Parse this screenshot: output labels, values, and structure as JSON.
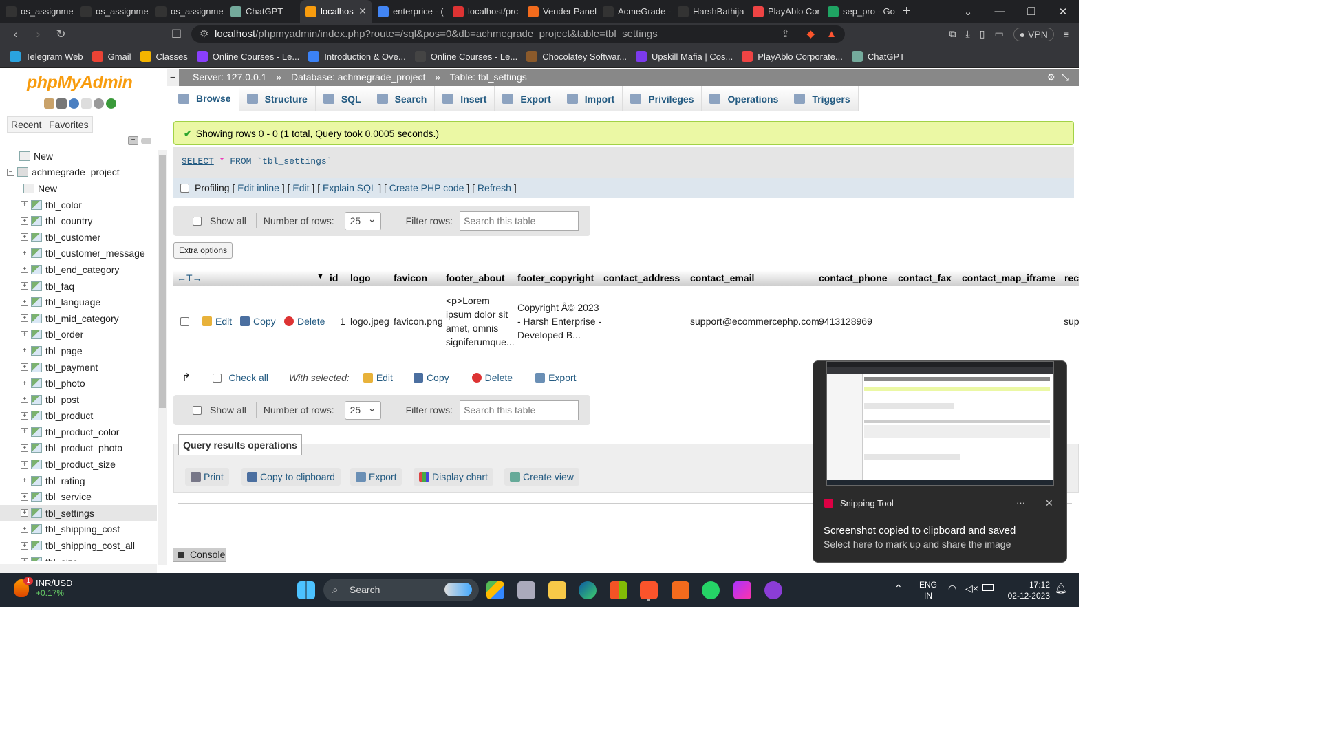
{
  "browser": {
    "tabs": [
      {
        "title": "os_assignme",
        "icon": "github-icon",
        "color": "#333"
      },
      {
        "title": "os_assignme",
        "icon": "github-icon",
        "color": "#333"
      },
      {
        "title": "os_assignme",
        "icon": "github-icon",
        "color": "#333"
      },
      {
        "title": "ChatGPT",
        "icon": "chatgpt-icon",
        "color": "#74aa9c"
      },
      {
        "title": "localhos",
        "icon": "phpmyadmin-icon",
        "color": "#f89c0e",
        "active": true
      },
      {
        "title": "enterprice - (",
        "icon": "google-icon",
        "color": "#4285f4"
      },
      {
        "title": "localhost/prc",
        "icon": "cart-icon",
        "color": "#d33"
      },
      {
        "title": "Vender Panel",
        "icon": "xampp-icon",
        "color": "#f26b1d"
      },
      {
        "title": "AcmeGrade -",
        "icon": "github-icon",
        "color": "#333"
      },
      {
        "title": "HarshBathija",
        "icon": "github-icon",
        "color": "#333"
      },
      {
        "title": "PlayAblo Cor",
        "icon": "location-icon",
        "color": "#e44"
      },
      {
        "title": "sep_pro - Go",
        "icon": "drive-icon",
        "color": "#1fa463"
      }
    ],
    "url_host": "localhost",
    "url_path": "/phpmyadmin/index.php?route=/sql&pos=0&db=achmegrade_project&table=tbl_settings",
    "vpn_label": "VPN",
    "bookmarks": [
      {
        "label": "Telegram Web",
        "color": "#2aa3df"
      },
      {
        "label": "Gmail",
        "color": "#ea4335"
      },
      {
        "label": "Classes",
        "color": "#f4b400"
      },
      {
        "label": "Online Courses - Le...",
        "color": "#8a3ffc"
      },
      {
        "label": "Introduction & Ove...",
        "color": "#3b82f6"
      },
      {
        "label": "Online Courses - Le...",
        "color": "#444"
      },
      {
        "label": "Chocolatey Softwar...",
        "color": "#8b5a2b"
      },
      {
        "label": "Upskill Mafia | Cos...",
        "color": "#7c3aed"
      },
      {
        "label": "PlayAblo Corporate...",
        "color": "#e44"
      },
      {
        "label": "ChatGPT",
        "color": "#74aa9c"
      }
    ]
  },
  "pma": {
    "logo_php": "php",
    "logo_my": "MyAdmin",
    "recent_label": "Recent",
    "favorites_label": "Favorites",
    "tree": {
      "new_label": "New",
      "db_name": "achmegrade_project",
      "db_new_label": "New",
      "tables": [
        "tbl_color",
        "tbl_country",
        "tbl_customer",
        "tbl_customer_message",
        "tbl_end_category",
        "tbl_faq",
        "tbl_language",
        "tbl_mid_category",
        "tbl_order",
        "tbl_page",
        "tbl_payment",
        "tbl_photo",
        "tbl_post",
        "tbl_product",
        "tbl_product_color",
        "tbl_product_photo",
        "tbl_product_size",
        "tbl_rating",
        "tbl_service",
        "tbl_settings",
        "tbl_shipping_cost",
        "tbl_shipping_cost_all",
        "tbl_size"
      ],
      "selected": "tbl_settings"
    },
    "breadcrumb": {
      "server": "Server: 127.0.0.1",
      "sep": "»",
      "database": "Database: achmegrade_project",
      "table": "Table: tbl_settings"
    },
    "menu": [
      "Browse",
      "Structure",
      "SQL",
      "Search",
      "Insert",
      "Export",
      "Import",
      "Privileges",
      "Operations",
      "Triggers"
    ],
    "success_msg": "Showing rows 0 - 0 (1 total, Query took 0.0005 seconds.)",
    "sql": {
      "select": "SELECT",
      "star": "*",
      "from": "FROM",
      "table": "`tbl_settings`"
    },
    "profiling": {
      "label": "Profiling",
      "links": [
        "Edit inline",
        "Edit",
        "Explain SQL",
        "Create PHP code",
        "Refresh"
      ]
    },
    "nav": {
      "show_all": "Show all",
      "rows_label": "Number of rows:",
      "rows_value": "25",
      "filter_label": "Filter rows:",
      "filter_placeholder": "Search this table"
    },
    "extra_options": "Extra options",
    "columns": [
      "id",
      "logo",
      "favicon",
      "footer_about",
      "footer_copyright",
      "contact_address",
      "contact_email",
      "contact_phone",
      "contact_fax",
      "contact_map_iframe",
      "rec"
    ],
    "row": {
      "edit": "Edit",
      "copy": "Copy",
      "delete": "Delete",
      "id": "1",
      "logo": "logo.jpeg",
      "favicon": "favicon.png",
      "footer_about": [
        "<p>Lorem",
        "ipsum dolor sit",
        "amet, omnis",
        "signiferumque..."
      ],
      "footer_copyright": [
        "Copyright Â© 2023",
        "- Harsh Enterprise -",
        "Developed B..."
      ],
      "contact_address": "",
      "contact_email": "support@ecommercephp.com",
      "contact_phone": "9413128969",
      "contact_fax": "",
      "contact_map_iframe": "",
      "rec": "sup"
    },
    "with_selected": {
      "check_all": "Check all",
      "label": "With selected:",
      "edit": "Edit",
      "copy": "Copy",
      "delete": "Delete",
      "export": "Export"
    },
    "qro": {
      "title": "Query results operations",
      "buttons": [
        "Print",
        "Copy to clipboard",
        "Export",
        "Display chart",
        "Create view"
      ]
    },
    "console": "Console"
  },
  "toast": {
    "app": "Snipping Tool",
    "title": "Screenshot copied to clipboard and saved",
    "subtitle": "Select here to mark up and share the image",
    "more": "···",
    "close": "✕"
  },
  "taskbar": {
    "stock_name": "INR/USD",
    "stock_change": "+0.17%",
    "stock_badge": "1",
    "search": "Search",
    "lang1": "ENG",
    "lang2": "IN",
    "time": "17:12",
    "date": "02-12-2023"
  }
}
